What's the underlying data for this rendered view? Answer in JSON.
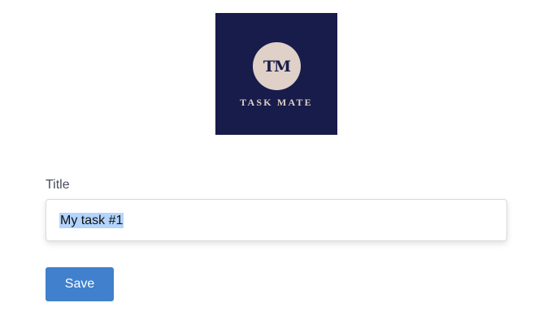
{
  "logo": {
    "initials": "TM",
    "wordmark": "TASK MATE"
  },
  "form": {
    "title_label": "Title",
    "title_value": "My task #1",
    "save_label": "Save"
  }
}
